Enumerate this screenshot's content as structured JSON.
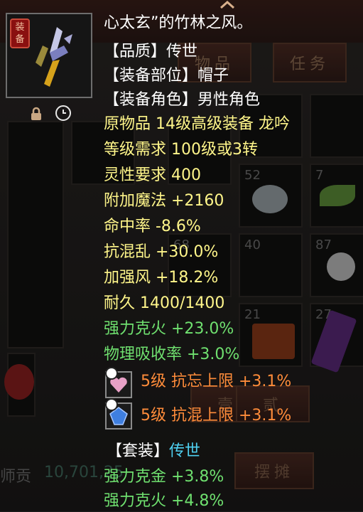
{
  "background": {
    "tabs": [
      "物品",
      "任务"
    ],
    "slot_counts": [
      "52",
      "7",
      "68",
      "40",
      "87",
      "21",
      "27"
    ],
    "buttons": [
      "壹",
      "贰",
      "摆摊"
    ],
    "currency_label": "师贡",
    "currency_value": "10,701,25"
  },
  "item": {
    "badge": "装备",
    "icon": "dagger-icon",
    "lock_icon": "lock-icon",
    "time_icon": "clock-icon"
  },
  "tooltip": {
    "name_line": "心太玄”的竹林之风。",
    "quality": {
      "bracket": "【品质】",
      "value": "传世"
    },
    "slot": {
      "bracket": "【装备部位】",
      "value": "帽子"
    },
    "gender": {
      "bracket": "【装备角色】",
      "value": "男性角色"
    },
    "origin": "原物品 14级高级装备 龙吟",
    "level_req": "等级需求 100级或3转",
    "spirit_req": "灵性要求 400",
    "attrs": [
      "附加魔法 +2160",
      "命中率 -8.6%",
      "抗混乱 +30.0%",
      "加强风 +18.2%",
      "耐久 1400/1400"
    ],
    "green_attrs": [
      "强力克火 +23.0%",
      "物理吸收率 +3.0%"
    ],
    "gems": [
      {
        "icon": "pink-gem-icon",
        "text": "5级 抗忘上限 +3.1%"
      },
      {
        "icon": "blue-gem-icon",
        "text": "5级 抗混上限 +3.1%"
      }
    ],
    "set": {
      "bracket": "【套装】",
      "value": "传世"
    },
    "set_attrs": [
      "强力克金 +3.8%",
      "强力克火 +4.8%"
    ]
  },
  "colors": {
    "white": "#ffffff",
    "yellow": "#fff68a",
    "green": "#6fe06f",
    "orange": "#ff8c3a",
    "cyan": "#4fd0f0"
  }
}
